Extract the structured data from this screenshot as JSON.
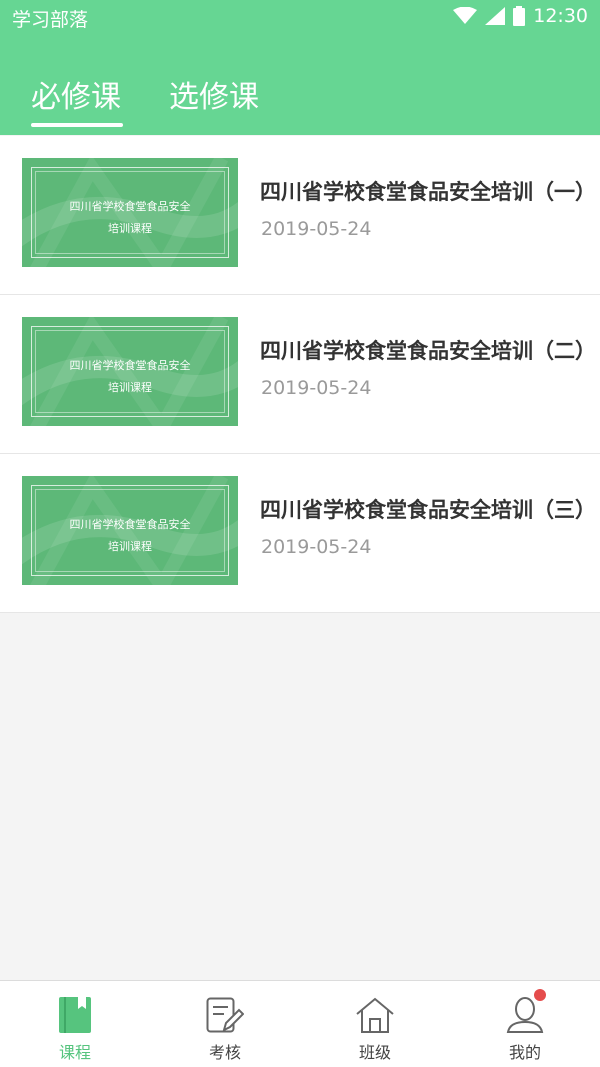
{
  "status_bar": {
    "app_name": "学习部落",
    "time": "12:30",
    "icons": [
      "wifi-icon",
      "signal-icon",
      "battery-icon"
    ]
  },
  "tabs": [
    {
      "label": "必修课",
      "active": true
    },
    {
      "label": "选修课",
      "active": false
    }
  ],
  "courses": [
    {
      "title": "四川省学校食堂食品安全培训（一）",
      "date": "2019-05-24",
      "thumb_line1": "四川省学校食堂食品安全",
      "thumb_line2": "培训课程"
    },
    {
      "title": "四川省学校食堂食品安全培训（二）",
      "date": "2019-05-24",
      "thumb_line1": "四川省学校食堂食品安全",
      "thumb_line2": "培训课程"
    },
    {
      "title": "四川省学校食堂食品安全培训（三）",
      "date": "2019-05-24",
      "thumb_line1": "四川省学校食堂食品安全",
      "thumb_line2": "培训课程"
    }
  ],
  "bottom_nav": [
    {
      "label": "课程",
      "icon": "book-icon",
      "active": true
    },
    {
      "label": "考核",
      "icon": "exam-edit-icon",
      "active": false
    },
    {
      "label": "班级",
      "icon": "house-icon",
      "active": false
    },
    {
      "label": "我的",
      "icon": "user-icon",
      "active": false,
      "badge": true
    }
  ],
  "colors": {
    "header": "#66d693",
    "accent": "#56c47e",
    "thumbnail": "#5db878",
    "badge": "#e54c4c"
  }
}
